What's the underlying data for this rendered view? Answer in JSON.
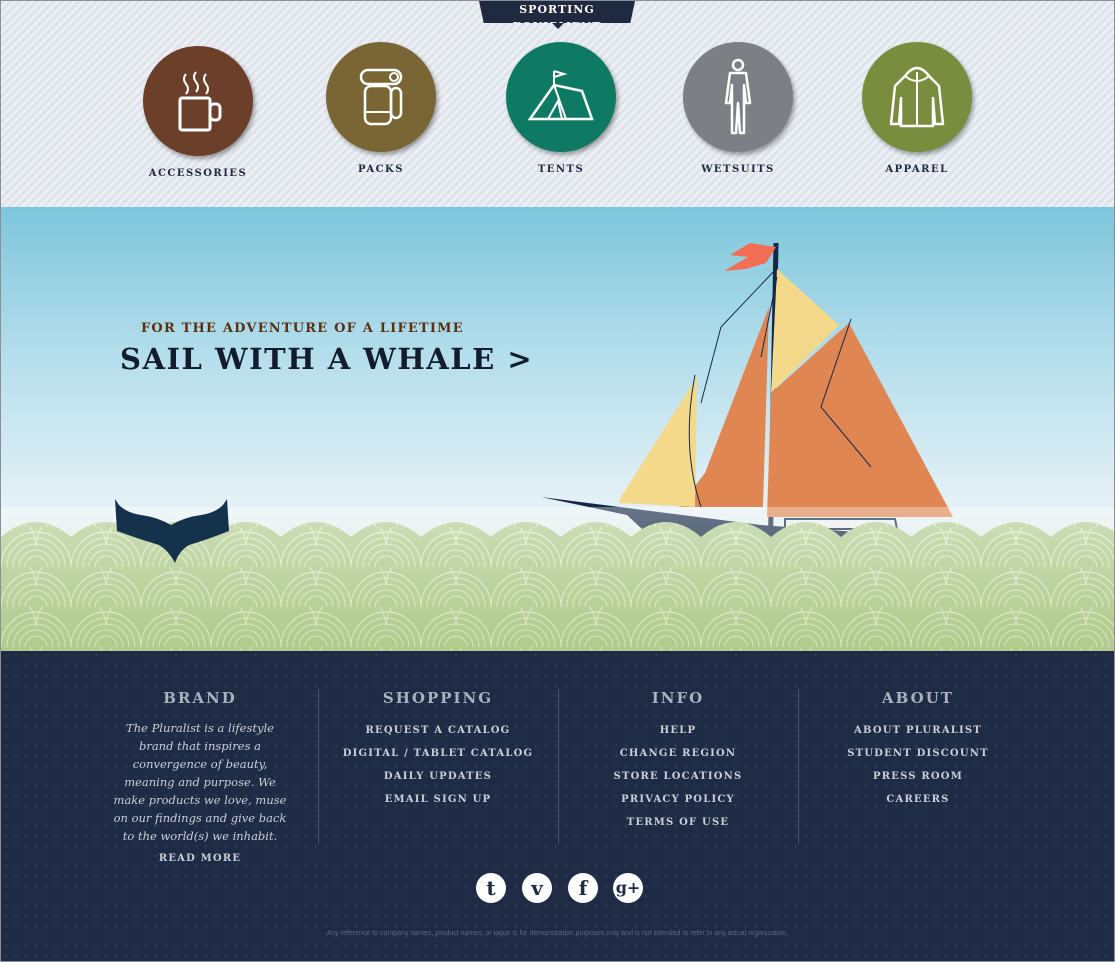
{
  "header_tab": "SPORTING EQUIPMENT",
  "categories": [
    {
      "label": "ACCESSORIES",
      "icon": "mug-icon",
      "color": "#6b3f2a"
    },
    {
      "label": "PACKS",
      "icon": "backpack-icon",
      "color": "#7a6535"
    },
    {
      "label": "TENTS",
      "icon": "tent-icon",
      "color": "#0f7a63"
    },
    {
      "label": "WETSUITS",
      "icon": "wetsuit-icon",
      "color": "#7c7f84"
    },
    {
      "label": "APPAREL",
      "icon": "jacket-icon",
      "color": "#7a8c3e"
    }
  ],
  "hero": {
    "kicker": "FOR THE ADVENTURE OF A LIFETIME",
    "headline": "SAIL WITH A WHALE >"
  },
  "footer": {
    "brand": {
      "title": "BRAND",
      "text": "The Pluralist is a lifestyle brand that inspires a convergence of beauty, meaning and purpose. We make products we love, muse on our findings and give back to the world(s) we inhabit.",
      "read_more": "READ MORE"
    },
    "shopping": {
      "title": "SHOPPING",
      "links": [
        "REQUEST A CATALOG",
        "DIGITAL / TABLET CATALOG",
        "DAILY UPDATES",
        "EMAIL SIGN UP"
      ]
    },
    "info": {
      "title": "INFO",
      "links": [
        "HELP",
        "CHANGE REGION",
        "STORE LOCATIONS",
        "PRIVACY POLICY",
        "TERMS OF USE"
      ]
    },
    "about": {
      "title": "ABOUT",
      "links": [
        "ABOUT PLURALIST",
        "STUDENT DISCOUNT",
        "PRESS ROOM",
        "CAREERS"
      ]
    },
    "social": [
      {
        "icon": "twitter-icon",
        "glyph": "t"
      },
      {
        "icon": "vimeo-icon",
        "glyph": "v"
      },
      {
        "icon": "facebook-icon",
        "glyph": "f"
      },
      {
        "icon": "google-plus-icon",
        "glyph": "g+"
      }
    ],
    "disclaimer": "Any reference to company names, product names, or logos is for demonstration purposes only and is not intended to refer to any actual organization."
  },
  "colors": {
    "navy": "#1f2b45",
    "sail_orange": "#e08652",
    "sail_yellow": "#f5d98a",
    "flag": "#f26f55",
    "waves": "#a8c48a"
  }
}
